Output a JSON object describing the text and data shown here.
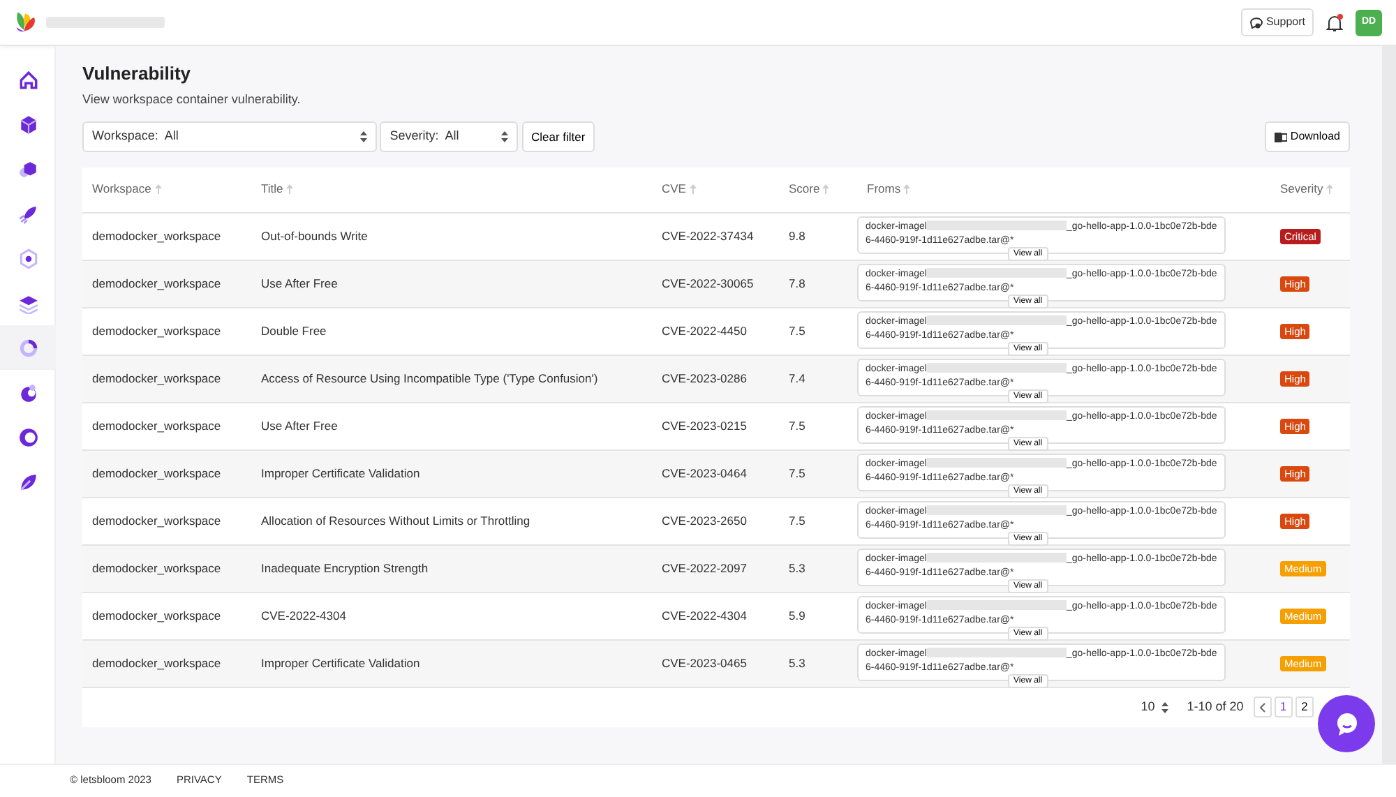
{
  "header": {
    "support": "Support",
    "notification": true,
    "avatar": "DD"
  },
  "sidebar": {
    "items": [
      {
        "kind": "home",
        "selected": false
      },
      {
        "kind": "cube",
        "selected": false
      },
      {
        "kind": "hexagon",
        "selected": false
      },
      {
        "kind": "rocket",
        "selected": false
      },
      {
        "kind": "target",
        "selected": false
      },
      {
        "kind": "layers",
        "selected": false
      },
      {
        "kind": "ring",
        "selected": true
      },
      {
        "kind": "swirl",
        "selected": false
      },
      {
        "kind": "moon",
        "selected": false
      },
      {
        "kind": "leaf",
        "selected": false
      }
    ]
  },
  "page": {
    "title": "Vulnerability",
    "subtitle": "View workspace container vulnerability."
  },
  "filters": {
    "workspace": {
      "label": "Workspace:",
      "value": "All"
    },
    "severity": {
      "label": "Severity:",
      "value": "All"
    },
    "clear": "Clear filter",
    "download": "Download"
  },
  "table": {
    "columns": [
      "Workspace",
      "Title",
      "CVE",
      "Score",
      "Froms",
      "Severity"
    ],
    "rows": [
      {
        "workspace": "demodocker_workspace",
        "title": "Out-of-bounds Write",
        "cve": "CVE-2022-37434",
        "score": "9.8",
        "from_start": "docker-imagel",
        "from_end": "_go-hello-app-1.0.0-1bc0e72b-bde6-4460-919f-1d11e627adbe.tar@*",
        "view_all": "View all",
        "severity": "Critical",
        "color": "#b91c1c"
      },
      {
        "workspace": "demodocker_workspace",
        "title": "Use After Free",
        "cve": "CVE-2022-30065",
        "score": "7.8",
        "from_start": "docker-imagel",
        "from_end": "_go-hello-app-1.0.0-1bc0e72b-bde6-4460-919f-1d11e627adbe.tar@*",
        "view_all": "View all",
        "severity": "High",
        "color": "#d9480f"
      },
      {
        "workspace": "demodocker_workspace",
        "title": "Double Free",
        "cve": "CVE-2022-4450",
        "score": "7.5",
        "from_start": "docker-imagel",
        "from_end": "_go-hello-app-1.0.0-1bc0e72b-bde6-4460-919f-1d11e627adbe.tar@*",
        "view_all": "View all",
        "severity": "High",
        "color": "#d9480f"
      },
      {
        "workspace": "demodocker_workspace",
        "title": "Access of Resource Using Incompatible Type ('Type Confusion')",
        "cve": "CVE-2023-0286",
        "score": "7.4",
        "from_start": "docker-imagel",
        "from_end": "_go-hello-app-1.0.0-1bc0e72b-bde6-4460-919f-1d11e627adbe.tar@*",
        "view_all": "View all",
        "severity": "High",
        "color": "#d9480f"
      },
      {
        "workspace": "demodocker_workspace",
        "title": "Use After Free",
        "cve": "CVE-2023-0215",
        "score": "7.5",
        "from_start": "docker-imagel",
        "from_end": "_go-hello-app-1.0.0-1bc0e72b-bde6-4460-919f-1d11e627adbe.tar@*",
        "view_all": "View all",
        "severity": "High",
        "color": "#d9480f"
      },
      {
        "workspace": "demodocker_workspace",
        "title": "Improper Certificate Validation",
        "cve": "CVE-2023-0464",
        "score": "7.5",
        "from_start": "docker-imagel",
        "from_end": "_go-hello-app-1.0.0-1bc0e72b-bde6-4460-919f-1d11e627adbe.tar@*",
        "view_all": "View all",
        "severity": "High",
        "color": "#d9480f"
      },
      {
        "workspace": "demodocker_workspace",
        "title": "Allocation of Resources Without Limits or Throttling",
        "cve": "CVE-2023-2650",
        "score": "7.5",
        "from_start": "docker-imagel",
        "from_end": "_go-hello-app-1.0.0-1bc0e72b-bde6-4460-919f-1d11e627adbe.tar@*",
        "view_all": "View all",
        "severity": "High",
        "color": "#d9480f"
      },
      {
        "workspace": "demodocker_workspace",
        "title": "Inadequate Encryption Strength",
        "cve": "CVE-2022-2097",
        "score": "5.3",
        "from_start": "docker-imagel",
        "from_end": "_go-hello-app-1.0.0-1bc0e72b-bde6-4460-919f-1d11e627adbe.tar@*",
        "view_all": "View all",
        "severity": "Medium",
        "color": "#f59f00"
      },
      {
        "workspace": "demodocker_workspace",
        "title": "CVE-2022-4304",
        "cve": "CVE-2022-4304",
        "score": "5.9",
        "from_start": "docker-imagel",
        "from_end": "_go-hello-app-1.0.0-1bc0e72b-bde6-4460-919f-1d11e627adbe.tar@*",
        "view_all": "View all",
        "severity": "Medium",
        "color": "#f59f00"
      },
      {
        "workspace": "demodocker_workspace",
        "title": "Improper Certificate Validation",
        "cve": "CVE-2023-0465",
        "score": "5.3",
        "from_start": "docker-imagel",
        "from_end": "_go-hello-app-1.0.0-1bc0e72b-bde6-4460-919f-1d11e627adbe.tar@*",
        "view_all": "View all",
        "severity": "Medium",
        "color": "#f59f00"
      }
    ]
  },
  "pagination": {
    "page_size": "10",
    "range": "1-10 of 20",
    "pages": [
      {
        "label": "1",
        "selected": true
      },
      {
        "label": "2",
        "selected": false
      }
    ]
  },
  "footer": {
    "copyright": "© letsbloom 2023",
    "links": [
      "PRIVACY",
      "TERMS"
    ]
  }
}
